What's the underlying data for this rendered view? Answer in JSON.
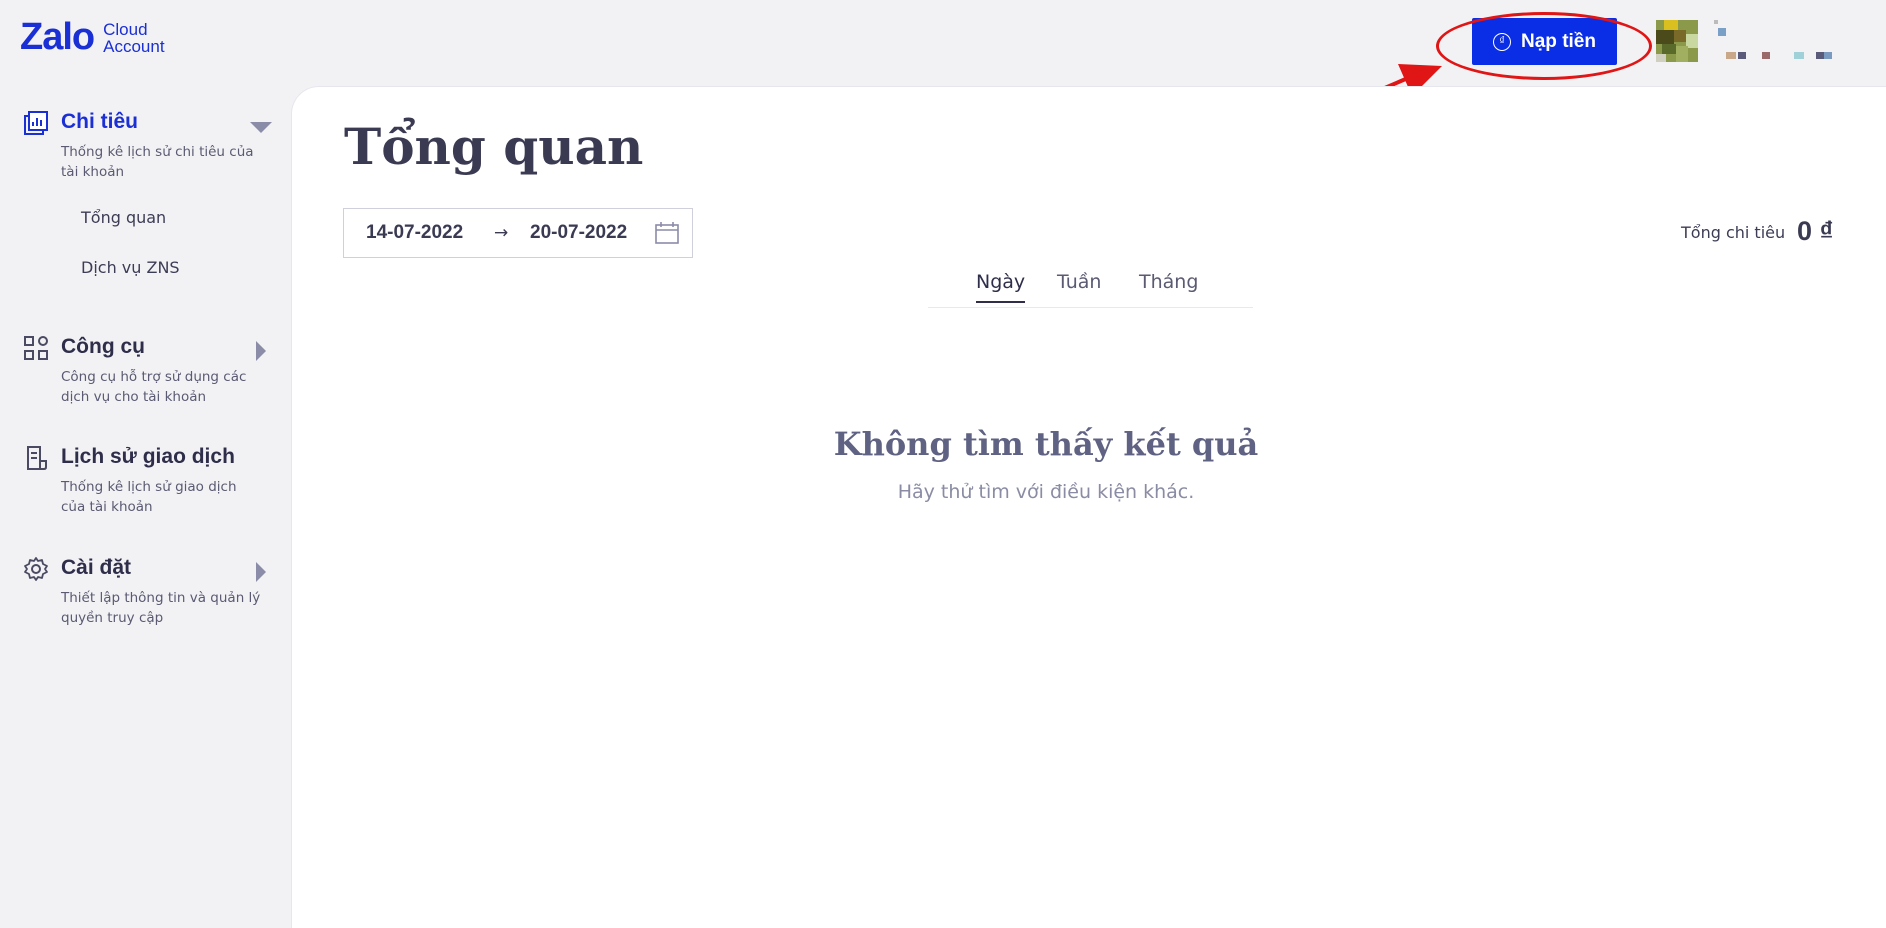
{
  "brand": {
    "name": "Zalo",
    "sub_line1": "Cloud",
    "sub_line2": "Account"
  },
  "header": {
    "topup_label": "Nạp tiền",
    "topup_icon": "coin-icon"
  },
  "sidebar": {
    "sections": [
      {
        "title": "Chi tiêu",
        "desc": "Thống kê lịch sử chi tiêu của tài khoản",
        "icon": "chart-report-icon",
        "expanded": true,
        "items": [
          "Tổng quan",
          "Dịch vụ ZNS"
        ]
      },
      {
        "title": "Công cụ",
        "desc": "Công cụ hỗ trợ sử dụng các dịch vụ cho tài khoản",
        "icon": "grid-apps-icon",
        "expanded": false
      },
      {
        "title": "Lịch sử giao dịch",
        "desc": "Thống kê lịch sử giao dịch của tài khoản",
        "icon": "receipt-icon",
        "expanded": false
      },
      {
        "title": "Cài đặt",
        "desc": "Thiết lập thông tin và quản lý quyền truy cập",
        "icon": "gear-icon",
        "expanded": false
      }
    ]
  },
  "main": {
    "title": "Tổng quan",
    "date_start": "14-07-2022",
    "date_sep": "→",
    "date_end": "20-07-2022",
    "total_label": "Tổng chi tiêu",
    "total_value": "0 ₫",
    "tabs": [
      "Ngày",
      "Tuần",
      "Tháng"
    ],
    "active_tab": "Ngày",
    "empty_title": "Không tìm thấy kết quả",
    "empty_sub": "Hãy thử tìm với điều kiện khác."
  },
  "colors": {
    "brand": "#1a2fd4",
    "button": "#0a2de6",
    "annotation": "#e01515"
  }
}
